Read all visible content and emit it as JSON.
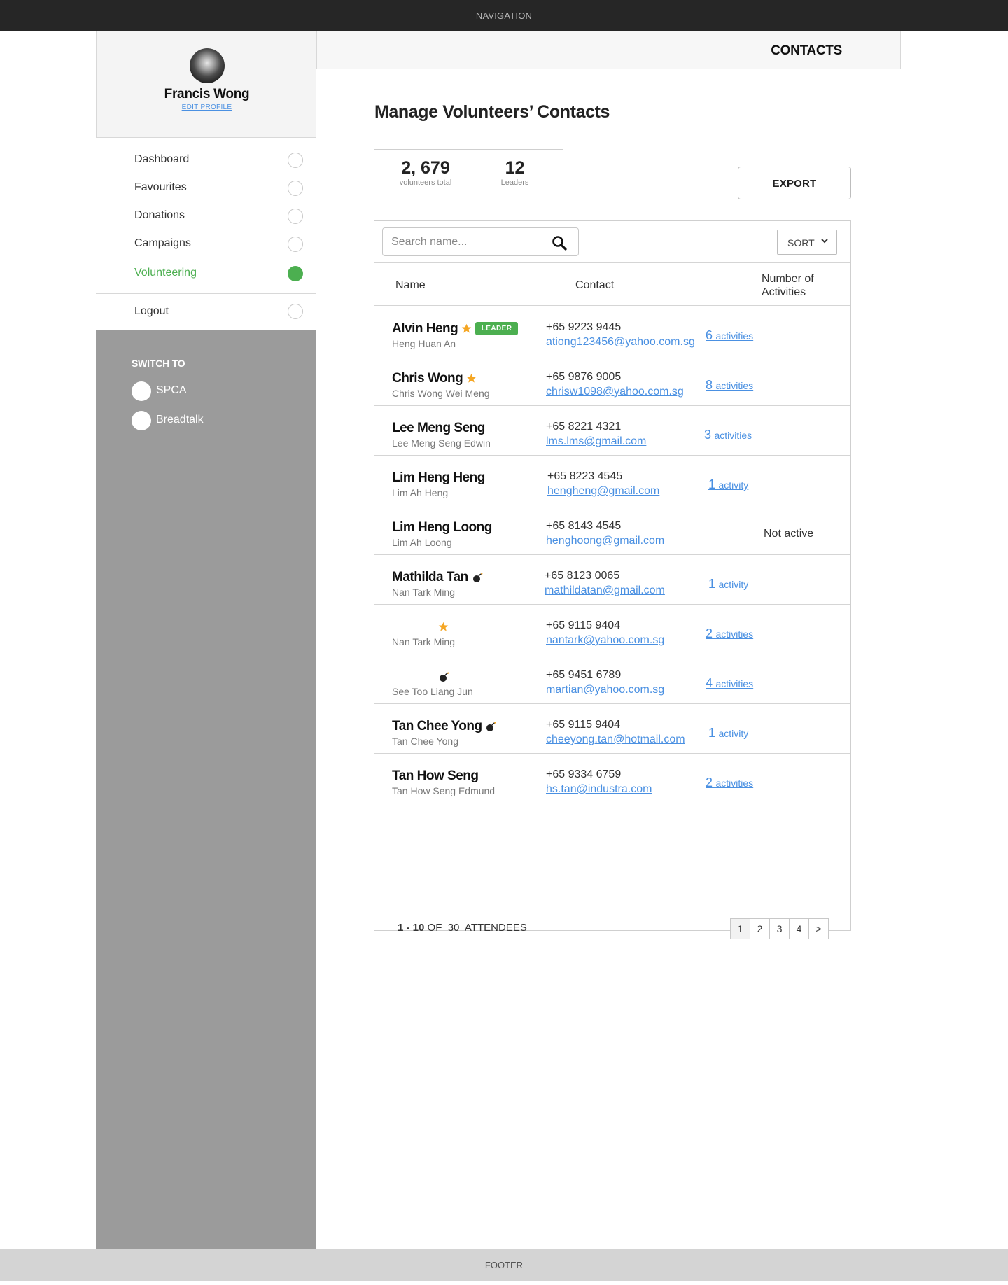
{
  "nav": {
    "label": "NAVIGATION"
  },
  "footer": {
    "label": "FOOTER"
  },
  "profile": {
    "name": "Francis Wong",
    "edit_label": "EDIT PROFILE"
  },
  "sidebar": {
    "items": [
      {
        "label": "Dashboard"
      },
      {
        "label": "Favourites"
      },
      {
        "label": "Donations"
      },
      {
        "label": "Campaigns"
      },
      {
        "label": "Volunteering"
      }
    ],
    "active_index": 4,
    "logout_label": "Logout",
    "switch_to_label": "SWITCH TO",
    "orgs": [
      {
        "label": "SPCA"
      },
      {
        "label": "Breadtalk"
      }
    ]
  },
  "header": {
    "title": "CONTACTS"
  },
  "page": {
    "title": "Manage Volunteers’ Contacts"
  },
  "stats": {
    "total_value": "2, 679",
    "total_caption": "volunteers total",
    "leaders_value": "12",
    "leaders_caption": "Leaders"
  },
  "export_label": "EXPORT",
  "search": {
    "placeholder": "Search name..."
  },
  "sort_label": "SORT",
  "table": {
    "headers": {
      "name": "Name",
      "contact": "Contact",
      "activities": "Number of Activities"
    },
    "rows": [
      {
        "name": "Alvin Heng",
        "sub": "Heng Huan An",
        "phone": "+65 9223 9445",
        "email": "ationg123456@yahoo.com.sg",
        "count": "6",
        "word": "activities",
        "star": true,
        "leader": true
      },
      {
        "name": "Chris Wong",
        "sub": "Chris Wong Wei Meng",
        "phone": "+65 9876 9005",
        "email": "chrisw1098@yahoo.com.sg",
        "count": "8",
        "word": "activities",
        "star": true
      },
      {
        "name": "Lee Meng Seng",
        "sub": "Lee Meng Seng Edwin",
        "phone": "+65 8221 4321",
        "email": "lms.lms@gmail.com",
        "count": "3",
        "word": "activities"
      },
      {
        "name": "Lim Heng Heng",
        "sub": "Lim Ah Heng",
        "phone": "+65 8223 4545",
        "email": "hengheng@gmail.com",
        "count": "1",
        "word": "activity"
      },
      {
        "name": "Lim Heng Loong",
        "sub": "Lim Ah Loong",
        "phone": "+65 8143 4545",
        "email": "henghoong@gmail.com",
        "status": "Not active"
      },
      {
        "name": "Mathilda Tan",
        "sub": "Nan Tark Ming",
        "phone": "+65 8123 0065",
        "email": "mathildatan@gmail.com",
        "count": "1",
        "word": "activity",
        "bomb": true
      },
      {
        "name": "",
        "sub": "Nan Tark Ming",
        "phone": "+65 9115 9404",
        "email": "nantark@yahoo.com.sg",
        "count": "2",
        "word": "activities",
        "star": true
      },
      {
        "name": "",
        "sub": "See Too Liang Jun",
        "phone": "+65 9451 6789",
        "email": "martian@yahoo.com.sg",
        "count": "4",
        "word": "activities",
        "bomb": true
      },
      {
        "name": "Tan Chee Yong",
        "sub": "Tan Chee Yong",
        "phone": "+65 9115 9404",
        "email": "cheeyong.tan@hotmail.com",
        "count": "1",
        "word": "activity",
        "bomb": true
      },
      {
        "name": "Tan How Seng",
        "sub": "Tan How Seng Edmund",
        "phone": "+65 9334 6759",
        "email": "hs.tan@industra.com",
        "count": "2",
        "word": "activities"
      }
    ],
    "leader_badge": "LEADER"
  },
  "pagination": {
    "range": "1 - 10",
    "of_label": "OF",
    "total": "30",
    "unit": "ATTENDEES",
    "pages": [
      "1",
      "2",
      "3",
      "4",
      ">"
    ],
    "current": "1"
  },
  "colors": {
    "accent_green": "#4caf50",
    "link_blue": "#4a90e2",
    "star_orange": "#f5a623",
    "sidebar_gray": "#9b9b9b"
  },
  "icons": {
    "star": "star-icon",
    "bomb": "bomb-icon",
    "search": "search-icon",
    "sort": "chevron-down-icon"
  }
}
